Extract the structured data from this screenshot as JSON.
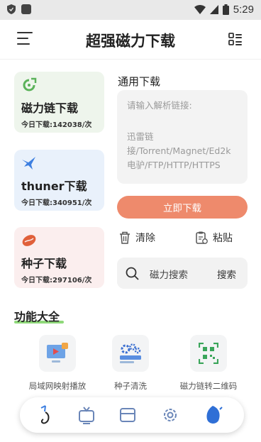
{
  "status_bar": {
    "time": "5:29"
  },
  "app_bar": {
    "title": "超强磁力下载"
  },
  "cards": [
    {
      "title": "磁力链下载",
      "count": "今日下载:142038/次",
      "icon": "magnet-link-icon",
      "accent": "#5bb25a"
    },
    {
      "title": "thuner下载",
      "count": "今日下载:340951/次",
      "icon": "thunder-bird-icon",
      "accent": "#3d7fe0"
    },
    {
      "title": "种子下载",
      "count": "今日下载:297106/次",
      "icon": "seed-icon",
      "accent": "#e0603a"
    }
  ],
  "general_download": {
    "title": "通用下载",
    "placeholder_line1": "请输入解析链接:",
    "placeholder_line2": "迅雷链接/Torrent/Magnet/Ed2k电驴/FTP/HTTP/HTTPS",
    "download_button": "立即下载",
    "clear_label": "清除",
    "paste_label": "粘贴"
  },
  "search": {
    "placeholder": "磁力搜索",
    "button": "搜索"
  },
  "features": {
    "title": "功能大全",
    "items": [
      {
        "label": "局域网映射播放",
        "icon": "screen-cast-icon"
      },
      {
        "label": "种子清洗",
        "icon": "seed-clean-icon"
      },
      {
        "label": "磁力链转二维码",
        "icon": "qr-code-icon"
      }
    ]
  },
  "bottom_nav": [
    "home-icon",
    "tv-icon",
    "card-icon",
    "settings-icon",
    "profile-icon"
  ],
  "colors": {
    "download_button": "#ee8a6c",
    "feature_underline": "#8fd97a"
  }
}
